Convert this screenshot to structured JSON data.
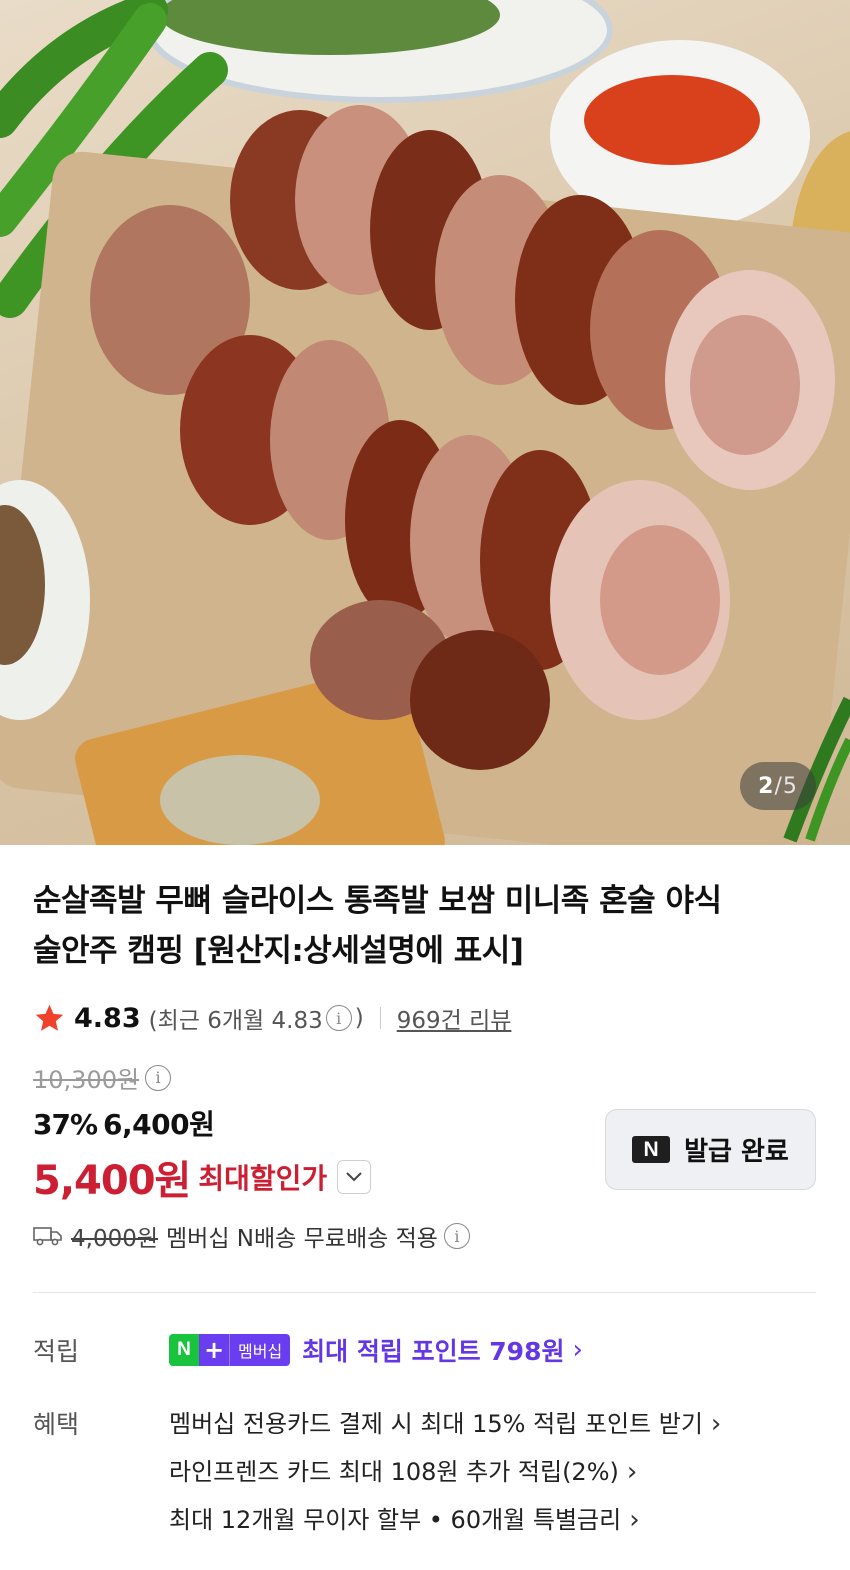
{
  "image": {
    "counter_current": "2",
    "counter_separator": "/",
    "counter_total": "5"
  },
  "product": {
    "title_line1": "순살족발 무뼈 슬라이스 통족발 보쌈 미니족 혼술 야식",
    "title_line2": "술안주 캠핑 [원산지:상세설명에 표시]",
    "rating": "4.83",
    "recent_open": "(최근 6개월 4.83",
    "recent_close": ")",
    "info_glyph": "i",
    "review_count_label": "969건 리뷰",
    "original_price": "10,300원",
    "discount_rate": "37%",
    "discount_price": "6,400원",
    "max_discount_price": "5,400원",
    "max_discount_label": "최대할인가",
    "coupon_logo": "N",
    "coupon_label": "발급 완료",
    "shipping_original": "4,000원",
    "shipping_text": "멤버십 N배송 무료배송 적용"
  },
  "benefits": {
    "points_label": "적립",
    "badge_n": "N",
    "badge_plus": "+",
    "badge_membership": "멤버십",
    "points_text": "최대 적립 포인트 798원",
    "benefit_label": "혜택",
    "items": [
      "멤버십 전용카드 결제 시 최대 15% 적립 포인트 받기",
      "라인프렌즈 카드 최대 108원 추가 적립(2%)",
      "최대 12개월 무이자 할부 • 60개월 특별금리"
    ],
    "arrow_glyph": "›"
  },
  "colors": {
    "accent_red": "#cc1f33",
    "accent_purple": "#6336e6",
    "naver_green": "#19c33d"
  },
  "icons": [
    "star-icon",
    "info-icon",
    "chevron-down-icon",
    "naver-n-icon",
    "truck-icon",
    "chevron-right-icon"
  ]
}
